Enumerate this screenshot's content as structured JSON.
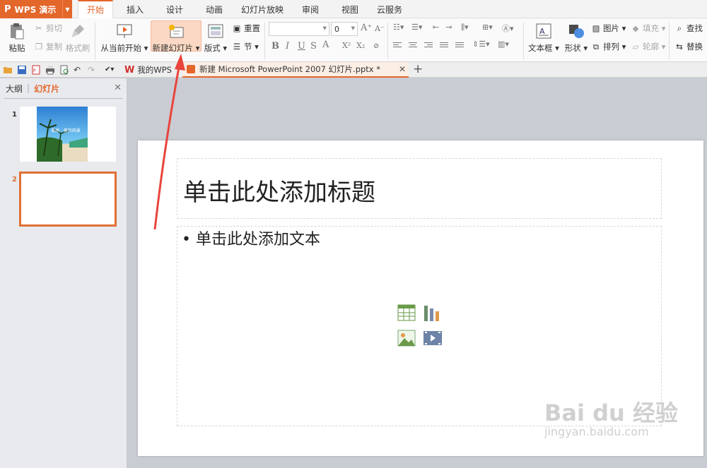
{
  "app": {
    "name": "WPS 演示",
    "logo": "P"
  },
  "tabs": [
    "开始",
    "插入",
    "设计",
    "动画",
    "幻灯片放映",
    "审阅",
    "视图",
    "云服务"
  ],
  "active_tab": "开始",
  "ribbon": {
    "paste": "粘贴",
    "cut": "剪切",
    "copy": "复制",
    "format_painter": "格式刷",
    "from_current": "从当前开始",
    "new_slide": "新建幻灯片",
    "layout": "版式",
    "reset": "重置",
    "section": "节",
    "font_size": "0",
    "text_box": "文本框",
    "shape": "形状",
    "picture": "图片",
    "fill": "填充",
    "arrange": "排列",
    "outline": "轮廓",
    "find": "查找",
    "replace": "替换"
  },
  "quickbar": {
    "my_wps": "我的WPS",
    "doc_tab": "新建 Microsoft PowerPoint 2007 幻灯片.pptx *"
  },
  "left_pane": {
    "tab_outline": "大纲",
    "tab_slides": "幻灯片",
    "slides": [
      {
        "number": "1",
        "thumb_caption": "美丽 · 美的风景"
      },
      {
        "number": "2",
        "thumb_caption": ""
      }
    ]
  },
  "slide": {
    "title_placeholder": "单击此处添加标题",
    "body_placeholder": "• 单击此处添加文本"
  },
  "colors": {
    "accent": "#e3662b",
    "arrow": "#e8453c",
    "selected_slide_border": "#e07035"
  },
  "watermark": {
    "brand": "Bai du 经验",
    "url": "jingyan.baidu.com"
  }
}
